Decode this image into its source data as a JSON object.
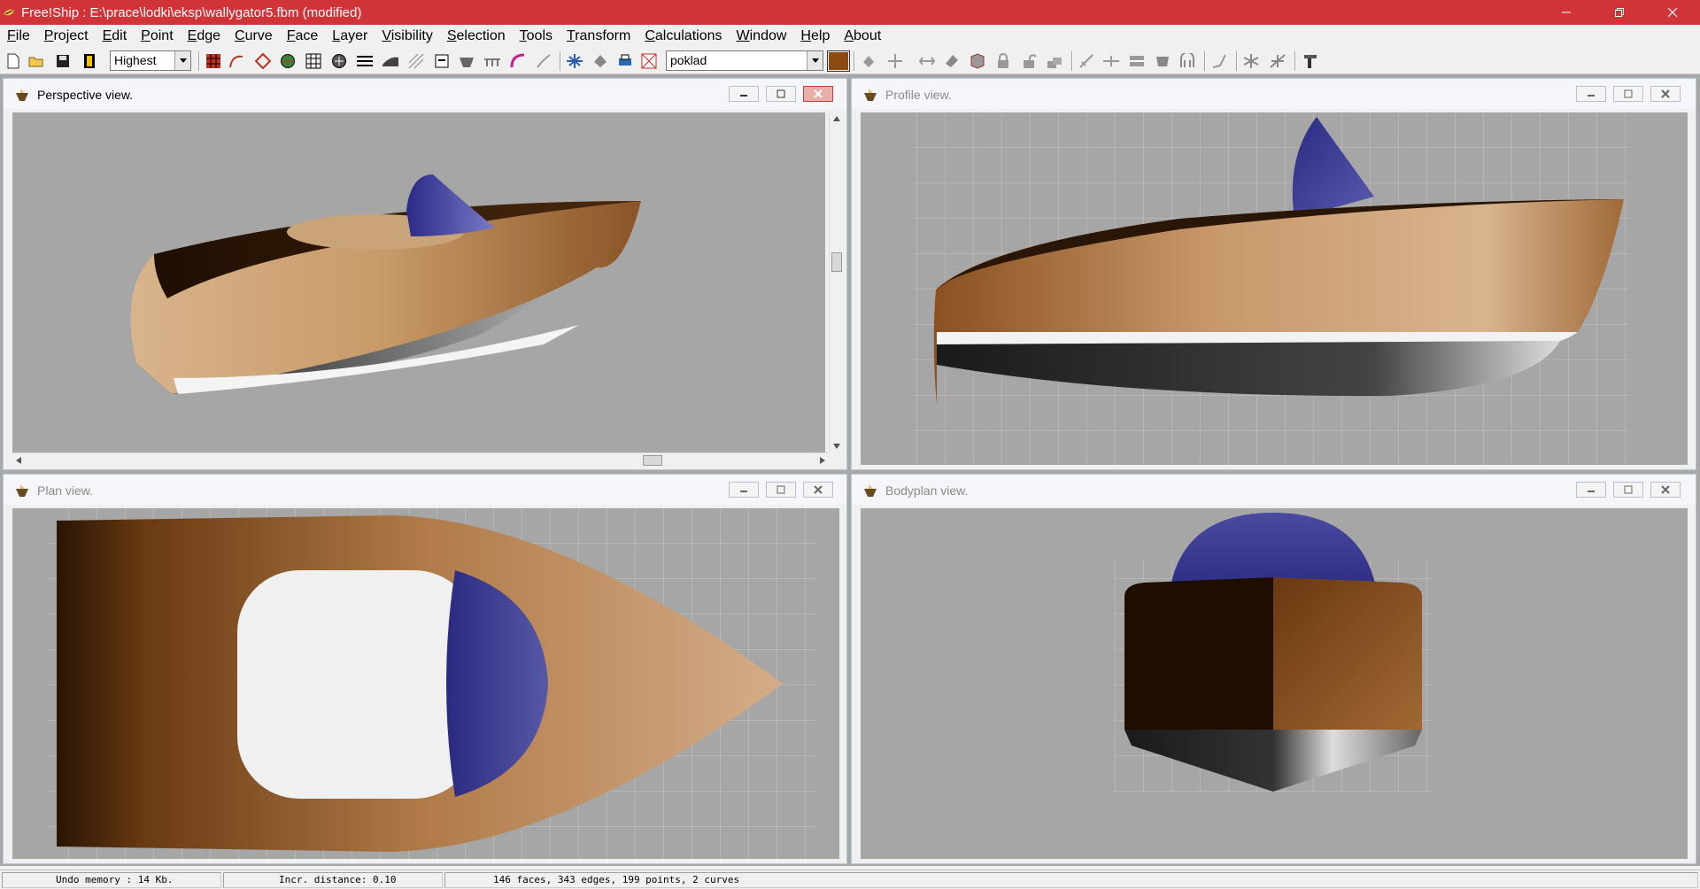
{
  "window": {
    "title": "Free!Ship : E:\\prace\\lodki\\eksp\\wallygator5.fbm (modified)",
    "accent_color": "#d13438"
  },
  "menu": [
    {
      "hot": "F",
      "rest": "ile"
    },
    {
      "hot": "P",
      "rest": "roject"
    },
    {
      "hot": "E",
      "rest": "dit"
    },
    {
      "hot": "P",
      "rest": "oint"
    },
    {
      "hot": "E",
      "rest": "dge"
    },
    {
      "hot": "C",
      "rest": "urve"
    },
    {
      "hot": "F",
      "rest": "ace"
    },
    {
      "hot": "L",
      "rest": "ayer"
    },
    {
      "hot": "V",
      "rest": "isibility"
    },
    {
      "hot": "S",
      "rest": "election"
    },
    {
      "hot": "T",
      "rest": "ools"
    },
    {
      "hot": "T",
      "rest": "ransform"
    },
    {
      "hot": "C",
      "rest": "alculations"
    },
    {
      "hot": "W",
      "rest": "indow"
    },
    {
      "hot": "H",
      "rest": "elp"
    },
    {
      "hot": "A",
      "rest": "bout"
    }
  ],
  "toolbar": {
    "precision_value": "Highest",
    "layer_value": "poklad",
    "layer_color": "#8b4a10"
  },
  "views": {
    "perspective": "Perspective view.",
    "profile": "Profile view.",
    "plan": "Plan view.",
    "bodyplan": "Bodyplan view."
  },
  "colors": {
    "hull_dark": "#2a1606",
    "hull_mid": "#9a6434",
    "hull_light": "#d0a880",
    "cabin_blue": "#3a3a98",
    "viewport_bg": "#a6a6a6"
  },
  "status": {
    "undo": "Undo memory : 14 Kb.",
    "incr": "Incr. distance: 0.10",
    "counts": "146 faces, 343 edges, 199 points, 2 curves"
  }
}
